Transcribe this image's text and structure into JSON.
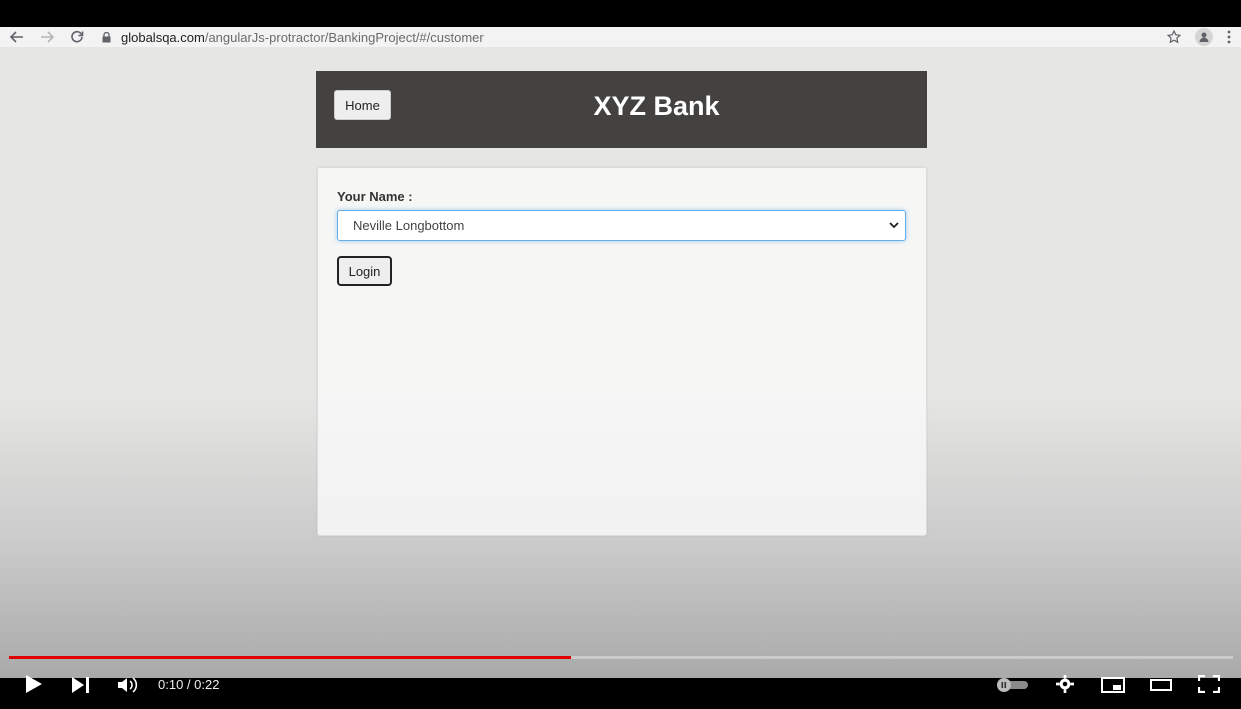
{
  "browser": {
    "url_host": "globalsqa.com",
    "url_path": "/angularJs-protractor/BankingProject/#/customer"
  },
  "bank": {
    "home_label": "Home",
    "title": "XYZ Bank"
  },
  "customer_login": {
    "name_label": "Your Name :",
    "selected_name": "Neville Longbottom",
    "login_label": "Login"
  },
  "video": {
    "time_display": "0:10 / 0:22",
    "progress_fraction": 0.459,
    "progress_color": "#e10000"
  }
}
